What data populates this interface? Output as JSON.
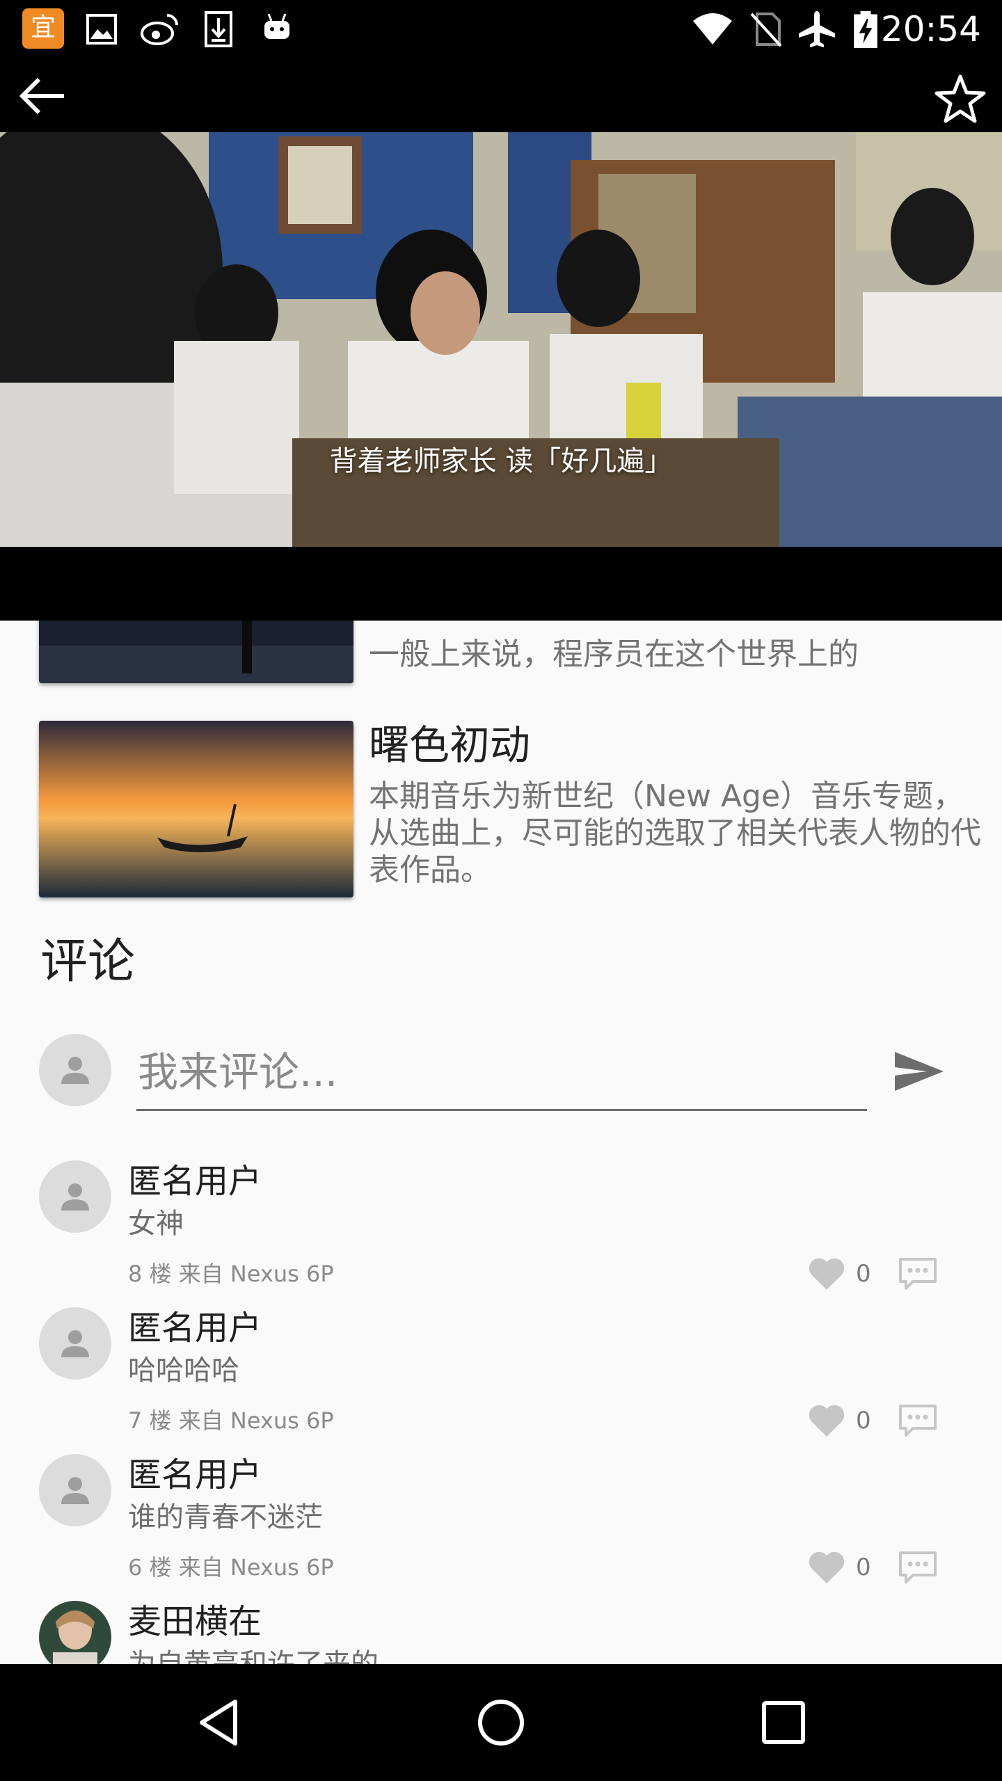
{
  "status_bar": {
    "time": "20:54",
    "app_icon_label": "宜",
    "notification_icons": [
      "gallery-icon",
      "weibo-icon",
      "download-icon",
      "android-icon"
    ],
    "system_icons": [
      "wifi-icon",
      "no-sim-icon",
      "airplane-mode-icon",
      "battery-charging-icon"
    ]
  },
  "app_bar": {
    "back_icon": "arrow-back-icon",
    "favorite_icon": "star-outline-icon"
  },
  "video": {
    "subtitle": "背着老师家长 读「好几遍」"
  },
  "articles": [
    {
      "title": "",
      "description": "一般上来说，程序员在这个世界上的"
    },
    {
      "title": "曙色初动",
      "description": "本期音乐为新世纪（New Age）音乐专题，从选曲上，尽可能的选取了相关代表人物的代表作品。"
    }
  ],
  "comments_section": {
    "title": "评论",
    "input_placeholder": "我来评论...",
    "send_icon": "send-icon",
    "comments": [
      {
        "user": "匿名用户",
        "text": "女神",
        "meta": "8 楼   来自 Nexus 6P",
        "likes": "0",
        "has_photo_avatar": false
      },
      {
        "user": "匿名用户",
        "text": "哈哈哈哈",
        "meta": "7 楼   来自 Nexus 6P",
        "likes": "0",
        "has_photo_avatar": false
      },
      {
        "user": "匿名用户",
        "text": "谁的青春不迷茫",
        "meta": "6 楼   来自 Nexus 6P",
        "likes": "0",
        "has_photo_avatar": false
      },
      {
        "user": "麦田横在",
        "text": "为自黄亮和许了来的",
        "meta": "",
        "likes": "",
        "has_photo_avatar": true
      }
    ]
  },
  "nav_bar": {
    "icons": [
      "nav-back-icon",
      "nav-home-icon",
      "nav-recents-icon"
    ]
  },
  "colors": {
    "background": "#fafafa",
    "bars": "#000000",
    "primary_text": "#212121",
    "secondary_text": "#737373",
    "icon_gray": "#c6c6c6"
  }
}
